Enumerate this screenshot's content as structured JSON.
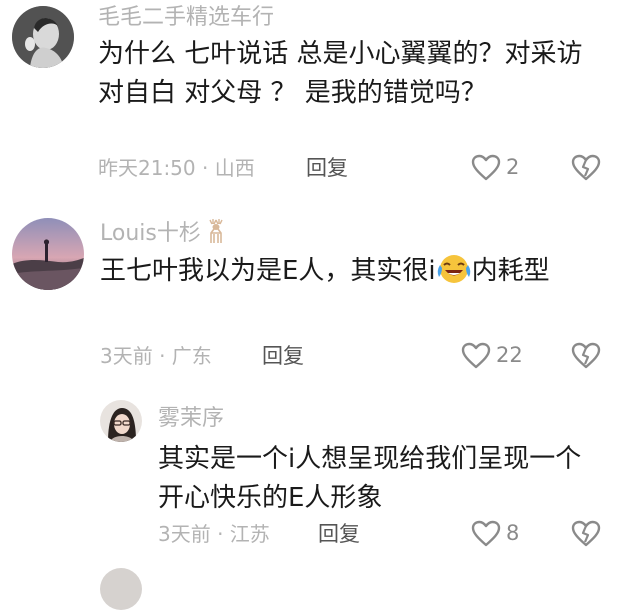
{
  "comments": [
    {
      "user": "毛毛二手精选车行",
      "text": "为什么 七叶说话 总是小心翼翼的？对采访 对自白 对父母 ？ 是我的错觉吗？",
      "meta": "昨天21:50 · 山西",
      "reply_label": "回复",
      "likes": "2"
    },
    {
      "user": "Louis十杉",
      "text_before": "王七叶我以为是E人，其实很i",
      "text_after": "内耗型",
      "meta": "3天前 · 广东",
      "reply_label": "回复",
      "likes": "22"
    },
    {
      "user": "雾茉序",
      "text": "其实是一个i人想呈现给我们呈现一个开心快乐的E人形象",
      "meta": "3天前 · 江苏",
      "reply_label": "回复",
      "likes": "8"
    }
  ],
  "icons": {
    "like": "heart-outline-icon",
    "dislike": "broken-heart-icon",
    "emoji": "laughing-crying-emoji-icon",
    "badge": "deer-icon"
  },
  "colors": {
    "text": "#1a1a1a",
    "muted": "#b3b3b3",
    "icon": "#8a8a8a"
  }
}
